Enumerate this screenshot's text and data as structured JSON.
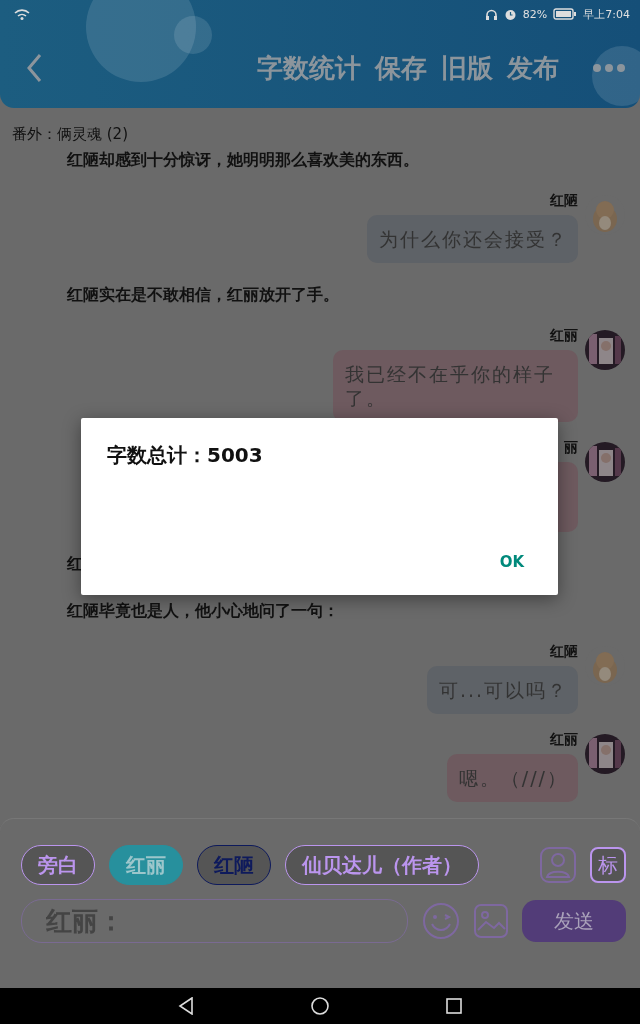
{
  "status_bar": {
    "battery": "82%",
    "time": "早上7:04"
  },
  "header": {
    "actions": [
      "字数统计",
      "保存",
      "旧版",
      "发布"
    ]
  },
  "chapter_title": "番外：俩灵魂 (2)",
  "chat": [
    {
      "kind": "narration",
      "text": "红陋却感到十分惊讶，她明明那么喜欢美的东西。"
    },
    {
      "kind": "message",
      "speaker": "红陋",
      "text": "为什么你还会接受？",
      "color": "#5e6267"
    },
    {
      "kind": "narration",
      "text": "红陋实在是不敢相信，红丽放开了手。"
    },
    {
      "kind": "message",
      "speaker": "红丽",
      "text": "我已经不在乎你的样子了。",
      "color": "#6e5a5f"
    },
    {
      "kind": "message",
      "speaker": "丽",
      "color": "#6e5a5f"
    },
    {
      "kind": "narration",
      "text": "红"
    },
    {
      "kind": "narration",
      "text": "红陋毕竟也是人，他小心地问了一句："
    },
    {
      "kind": "message",
      "speaker": "红陋",
      "text": "可...可以吗？",
      "color": "#5e6267"
    },
    {
      "kind": "message",
      "speaker": "红丽",
      "text": "嗯。（///）",
      "color": "#6e5a5f"
    }
  ],
  "roles": [
    {
      "label": "旁白",
      "selected": false,
      "color": "#bb95ee"
    },
    {
      "label": "红丽",
      "selected": true,
      "color": "#27909d"
    },
    {
      "label": "红陋",
      "selected": false,
      "color": "#0e1a5c"
    },
    {
      "label": "仙贝达儿（作者）",
      "selected": false,
      "color": "#bb95ee"
    }
  ],
  "tag_button": "标",
  "input": {
    "placeholder": "红丽："
  },
  "send_button": "发送",
  "dialog": {
    "title": "字数总计：5003",
    "button": "OK"
  }
}
